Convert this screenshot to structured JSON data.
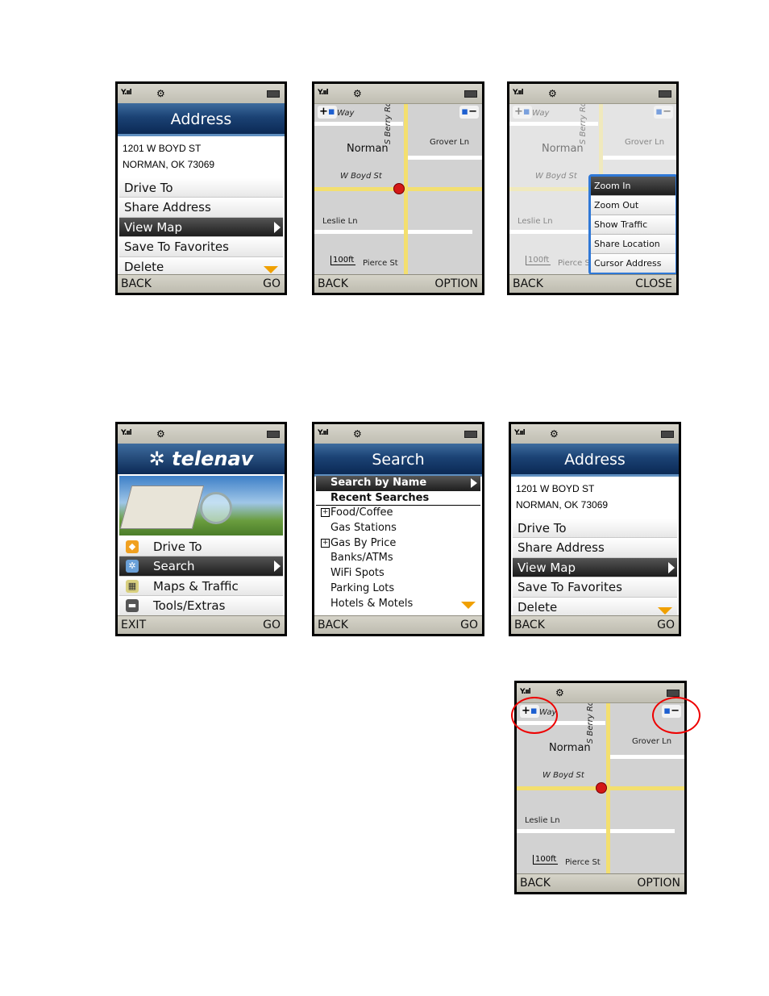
{
  "status": {
    "signal": "Y.ııl",
    "gps_icon": "gps-icon",
    "battery_icon": "battery-icon"
  },
  "address_screen": {
    "title": "Address",
    "line1": "1201 W BOYD ST",
    "line2": "NORMAN, OK 73069",
    "items": [
      "Drive To",
      "Share Address",
      "View Map",
      "Save To Favorites",
      "Delete"
    ],
    "selected": "View Map",
    "back": "BACK",
    "go": "GO"
  },
  "map": {
    "labels": {
      "way": "Way",
      "norman": "Norman",
      "berry": "S Berry Rd",
      "grover": "Grover Ln",
      "boyd": "W Boyd St",
      "leslie": "Leslie Ln",
      "scale": "100ft",
      "pierce": "Pierce St"
    },
    "zoom_in": "+",
    "zoom_out": "−",
    "back": "BACK",
    "option": "OPTION",
    "close": "CLOSE"
  },
  "map_popup": {
    "items": [
      "Zoom In",
      "Zoom Out",
      "Show Traffic",
      "Share Location",
      "Cursor Address"
    ],
    "selected": "Zoom In"
  },
  "home_screen": {
    "logo": "telenav",
    "items": [
      "Drive To",
      "Search",
      "Maps & Traffic",
      "Tools/Extras"
    ],
    "selected": "Search",
    "exit": "EXIT",
    "go": "GO"
  },
  "search_screen": {
    "title": "Search",
    "items": [
      "Search by Name",
      "Recent Searches",
      "Food/Coffee",
      "Gas Stations",
      "Gas By Price",
      "Banks/ATMs",
      "WiFi Spots",
      "Parking Lots",
      "Hotels & Motels"
    ],
    "back": "BACK",
    "go": "GO"
  },
  "colors": {
    "title_bar": "#1b4274",
    "highlight": "#2f78d6",
    "road": "#f3df6f",
    "pin": "#d31717",
    "circle": "#e00000"
  }
}
